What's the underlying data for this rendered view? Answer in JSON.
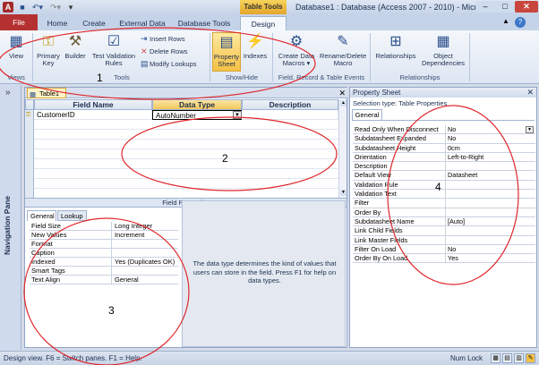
{
  "titlebar": {
    "app_icon": "A",
    "context_tab": "Table Tools",
    "window_title": "Database1 : Database (Access 2007 - 2010)  -  Micr...",
    "minimize_glyph": "–",
    "maximize_glyph": "□",
    "close_glyph": "✕",
    "save_icon": "save-icon",
    "undo_icon": "undo-icon",
    "redo_icon": "redo-icon"
  },
  "tabs": {
    "file": "File",
    "home": "Home",
    "create": "Create",
    "external": "External Data",
    "dbtools": "Database Tools",
    "design": "Design",
    "expand_glyph": "▲",
    "help_glyph": "?"
  },
  "ribbon": {
    "view": "View",
    "primary_key": "Primary Key",
    "builder": "Builder",
    "test_validation": "Test Validation Rules",
    "insert_rows": "Insert Rows",
    "delete_rows": "Delete Rows",
    "modify_lookups": "Modify Lookups",
    "property_sheet": "Property Sheet",
    "indexes": "Indexes",
    "create_data_macros": "Create Data Macros ▾",
    "rename_delete_macro": "Rename/Delete Macro",
    "relationships": "Relationships",
    "object_dependencies": "Object Dependencies",
    "groups": {
      "views": "Views",
      "tools": "Tools",
      "show_hide": "Show/Hide",
      "field_record": "Field, Record & Table Events",
      "relationships": "Relationships"
    }
  },
  "nav": {
    "toggle": "»",
    "label": "Navigation Pane"
  },
  "document": {
    "tab_label": "Table1",
    "close_glyph": "✕",
    "headers": {
      "field_name": "Field Name",
      "data_type": "Data Type",
      "description": "Description"
    },
    "rows": [
      {
        "field": "CustomerID",
        "type": "AutoNumber",
        "desc": ""
      }
    ],
    "field_properties_label": "Field Properties",
    "fp_tabs": {
      "general": "General",
      "lookup": "Lookup"
    },
    "fp_rows": [
      {
        "k": "Field Size",
        "v": "Long Integer"
      },
      {
        "k": "New Values",
        "v": "Increment"
      },
      {
        "k": "Format",
        "v": ""
      },
      {
        "k": "Caption",
        "v": ""
      },
      {
        "k": "Indexed",
        "v": "Yes (Duplicates OK)"
      },
      {
        "k": "Smart Tags",
        "v": ""
      },
      {
        "k": "Text Align",
        "v": "General"
      }
    ],
    "help_text": "The data type determines the kind of values that users can store in the field. Press F1 for help on data types."
  },
  "property_sheet": {
    "title": "Property Sheet",
    "close_glyph": "✕",
    "selection_type": "Selection type:  Table Properties",
    "tab": "General",
    "rows": [
      {
        "k": "Read Only When Disconnect",
        "v": "No"
      },
      {
        "k": "Subdatasheet Expanded",
        "v": "No"
      },
      {
        "k": "Subdatasheet Height",
        "v": "0cm"
      },
      {
        "k": "Orientation",
        "v": "Left-to-Right"
      },
      {
        "k": "Description",
        "v": ""
      },
      {
        "k": "Default View",
        "v": "Datasheet"
      },
      {
        "k": "Validation Rule",
        "v": ""
      },
      {
        "k": "Validation Text",
        "v": ""
      },
      {
        "k": "Filter",
        "v": ""
      },
      {
        "k": "Order By",
        "v": ""
      },
      {
        "k": "Subdatasheet Name",
        "v": "[Auto]"
      },
      {
        "k": "Link Child Fields",
        "v": ""
      },
      {
        "k": "Link Master Fields",
        "v": ""
      },
      {
        "k": "Filter On Load",
        "v": "No"
      },
      {
        "k": "Order By On Load",
        "v": "Yes"
      }
    ]
  },
  "status": {
    "text": "Design view.  F6 = Switch panes.  F1 = Help.",
    "numlock": "Num Lock"
  },
  "annotations": {
    "n1": "1",
    "n2": "2",
    "n3": "3",
    "n4": "4",
    "color": "#e0262b"
  }
}
